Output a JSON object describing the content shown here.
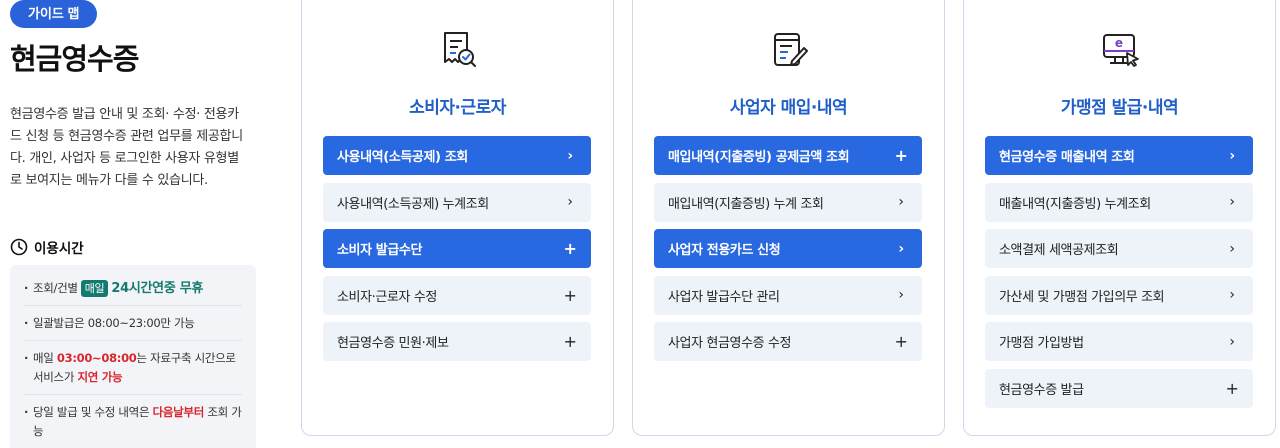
{
  "left": {
    "guide_map_label": "가이드 맵",
    "title": "현금영수증",
    "description": "현금영수증 발급 안내 및 조회· 수정· 전용카드 신청 등 현금영수증 관련 업무를 제공합니다. 개인, 사업자 등 로그인한 사용자 유형별로 보여지는 메뉴가 다를 수 있습니다.",
    "hours_title": "이용시간",
    "hours": {
      "item1_prefix": "조회/건별",
      "item1_badge": "매일",
      "item1_em": "24시간연중 무휴",
      "item2": "일괄발급은 08:00~23:00만 가능",
      "item3_prefix": "매일 ",
      "item3_red": "03:00~08:00",
      "item3_mid": "는 자료구축 시간으로 서비스가 ",
      "item3_red2": "지연 가능",
      "item4_prefix": "당일 발급 및 수정 내역은 ",
      "item4_red": "다음날부터",
      "item4_suffix": " 조회 가능"
    }
  },
  "cards": [
    {
      "title": "소비자·근로자",
      "icon": "receipt-check-icon",
      "items": [
        {
          "label": "사용내역(소득공제) 조회",
          "trail": "›",
          "active": true
        },
        {
          "label": "사용내역(소득공제) 누계조회",
          "trail": "›",
          "active": false
        },
        {
          "label": "소비자 발급수단",
          "trail": "+",
          "active": true
        },
        {
          "label": "소비자·근로자 수정",
          "trail": "+",
          "active": false
        },
        {
          "label": "현금영수증 민원·제보",
          "trail": "+",
          "active": false
        }
      ]
    },
    {
      "title": "사업자 매입·내역",
      "icon": "document-pen-icon",
      "items": [
        {
          "label": "매입내역(지출증빙) 공제금액 조회",
          "trail": "+",
          "active": true
        },
        {
          "label": "매입내역(지출증빙) 누계 조회",
          "trail": "›",
          "active": false
        },
        {
          "label": "사업자 전용카드 신청",
          "trail": "›",
          "active": true
        },
        {
          "label": "사업자 발급수단 관리",
          "trail": "›",
          "active": false
        },
        {
          "label": "사업자 현금영수증 수정",
          "trail": "+",
          "active": false
        }
      ]
    },
    {
      "title": "가맹점 발급·내역",
      "icon": "computer-click-icon",
      "items": [
        {
          "label": "현금영수증 매출내역 조회",
          "trail": "›",
          "active": true
        },
        {
          "label": "매출내역(지출증빙) 누계조회",
          "trail": "›",
          "active": false
        },
        {
          "label": "소액결제 세액공제조회",
          "trail": "›",
          "active": false
        },
        {
          "label": "가산세 및 가맹점 가입의무 조회",
          "trail": "›",
          "active": false
        },
        {
          "label": "가맹점 가입방법",
          "trail": "›",
          "active": false
        },
        {
          "label": "현금영수증 발급",
          "trail": "+",
          "active": false
        }
      ]
    }
  ],
  "colors": {
    "accent": "#2868e0",
    "title_blue": "#1f5fc7",
    "green": "#127a6e",
    "red": "#d8262e"
  }
}
